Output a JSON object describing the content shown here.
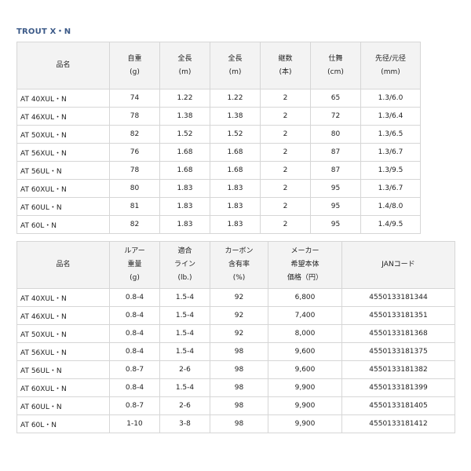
{
  "title": "TROUT X・N",
  "table1": {
    "headers": [
      [
        "品名"
      ],
      [
        "自重",
        "(g)"
      ],
      [
        "全長",
        "(m)"
      ],
      [
        "全長",
        "(m)"
      ],
      [
        "継数",
        "(本)"
      ],
      [
        "仕舞",
        "(cm)"
      ],
      [
        "先径/元径",
        "(mm)"
      ]
    ],
    "rows": [
      [
        "AT 40XUL・N",
        "74",
        "1.22",
        "1.22",
        "2",
        "65",
        "1.3/6.0"
      ],
      [
        "AT 46XUL・N",
        "78",
        "1.38",
        "1.38",
        "2",
        "72",
        "1.3/6.4"
      ],
      [
        "AT 50XUL・N",
        "82",
        "1.52",
        "1.52",
        "2",
        "80",
        "1.3/6.5"
      ],
      [
        "AT 56XUL・N",
        "76",
        "1.68",
        "1.68",
        "2",
        "87",
        "1.3/6.7"
      ],
      [
        "AT 56UL・N",
        "78",
        "1.68",
        "1.68",
        "2",
        "87",
        "1.3/9.5"
      ],
      [
        "AT 60XUL・N",
        "80",
        "1.83",
        "1.83",
        "2",
        "95",
        "1.3/6.7"
      ],
      [
        "AT 60UL・N",
        "81",
        "1.83",
        "1.83",
        "2",
        "95",
        "1.4/8.0"
      ],
      [
        "AT 60L・N",
        "82",
        "1.83",
        "1.83",
        "2",
        "95",
        "1.4/9.5"
      ]
    ]
  },
  "table2": {
    "headers": [
      [
        "品名"
      ],
      [
        "ルアー",
        "重量",
        "(g)"
      ],
      [
        "適合",
        "ライン",
        "(lb.)"
      ],
      [
        "カーボン",
        "含有率",
        "(%)"
      ],
      [
        "メーカー",
        "希望本体",
        "価格（円）"
      ],
      [
        "JANコード"
      ]
    ],
    "rows": [
      [
        "AT 40XUL・N",
        "0.8-4",
        "1.5-4",
        "92",
        "6,800",
        "4550133181344"
      ],
      [
        "AT 46XUL・N",
        "0.8-4",
        "1.5-4",
        "92",
        "7,400",
        "4550133181351"
      ],
      [
        "AT 50XUL・N",
        "0.8-4",
        "1.5-4",
        "92",
        "8,000",
        "4550133181368"
      ],
      [
        "AT 56XUL・N",
        "0.8-4",
        "1.5-4",
        "98",
        "9,600",
        "4550133181375"
      ],
      [
        "AT 56UL・N",
        "0.8-7",
        "2-6",
        "98",
        "9,600",
        "4550133181382"
      ],
      [
        "AT 60XUL・N",
        "0.8-4",
        "1.5-4",
        "98",
        "9,900",
        "4550133181399"
      ],
      [
        "AT 60UL・N",
        "0.8-7",
        "2-6",
        "98",
        "9,900",
        "4550133181405"
      ],
      [
        "AT 60L・N",
        "1-10",
        "3-8",
        "98",
        "9,900",
        "4550133181412"
      ]
    ]
  }
}
